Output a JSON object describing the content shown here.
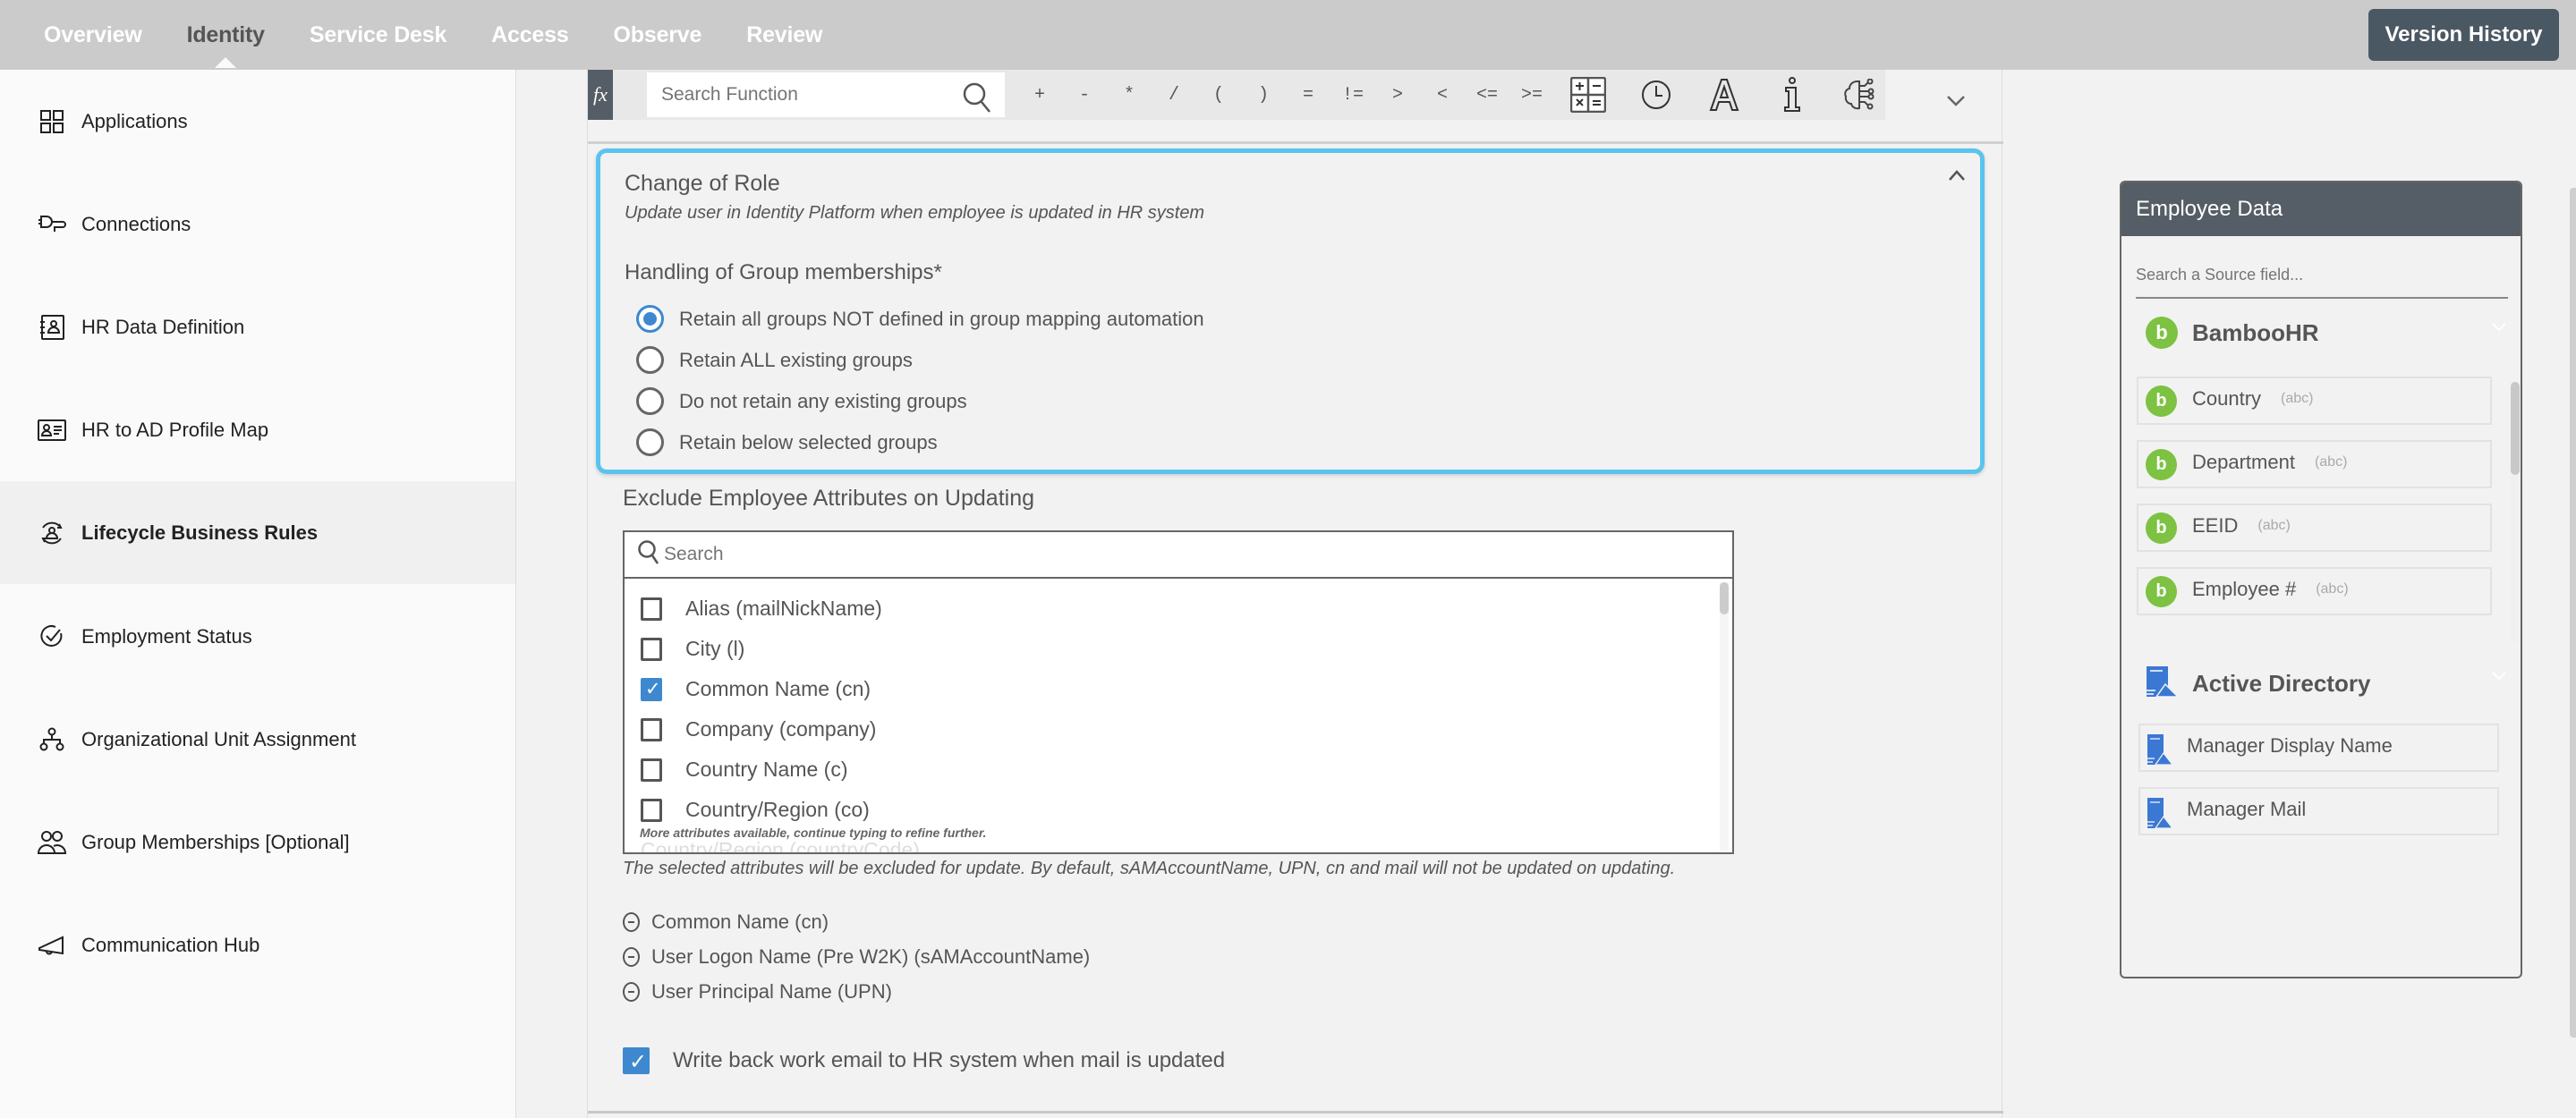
{
  "topnav": {
    "tabs": [
      {
        "label": "Overview",
        "active": false
      },
      {
        "label": "Identity",
        "active": true
      },
      {
        "label": "Service Desk",
        "active": false
      },
      {
        "label": "Access",
        "active": false
      },
      {
        "label": "Observe",
        "active": false
      },
      {
        "label": "Review",
        "active": false
      }
    ],
    "version_history_label": "Version History"
  },
  "sidebar": {
    "items": [
      {
        "label": "Applications",
        "icon": "applications-grid-icon",
        "active": false
      },
      {
        "label": "Connections",
        "icon": "plug-icon",
        "active": false
      },
      {
        "label": "HR Data Definition",
        "icon": "contact-book-icon",
        "active": false
      },
      {
        "label": "HR to AD Profile Map",
        "icon": "id-card-icon",
        "active": false
      },
      {
        "label": "Lifecycle Business Rules",
        "icon": "lifecycle-user-icon",
        "active": true
      },
      {
        "label": "Employment Status",
        "icon": "check-circle-icon",
        "active": false
      },
      {
        "label": "Organizational Unit Assignment",
        "icon": "org-hierarchy-icon",
        "active": false
      },
      {
        "label": "Group Memberships [Optional]",
        "icon": "users-group-icon",
        "active": false
      },
      {
        "label": "Communication Hub",
        "icon": "megaphone-icon",
        "active": false
      }
    ]
  },
  "formula_bar": {
    "fx_label": "fx",
    "search_placeholder": "Search Function",
    "operators": [
      "+",
      "-",
      "*",
      "/",
      "(",
      ")",
      "=",
      "!=",
      ">",
      "<",
      "<=",
      ">="
    ],
    "tools": [
      "calculator-icon",
      "clock-icon",
      "text-a-icon",
      "info-icon",
      "ai-brain-icon"
    ]
  },
  "role_card": {
    "title": "Change of Role",
    "subtitle": "Update user in Identity Platform when employee is updated in HR system",
    "handling_label": "Handling of Group memberships*",
    "options": [
      {
        "label": "Retain all groups NOT defined in group mapping automation",
        "selected": true
      },
      {
        "label": "Retain ALL existing groups",
        "selected": false
      },
      {
        "label": "Do not retain any existing groups",
        "selected": false
      },
      {
        "label": "Retain below selected groups",
        "selected": false
      }
    ]
  },
  "exclude": {
    "label": "Exclude Employee Attributes on Updating",
    "search_placeholder": "Search",
    "attributes": [
      {
        "label": "Alias (mailNickName)",
        "checked": false
      },
      {
        "label": "City (l)",
        "checked": false
      },
      {
        "label": "Common Name (cn)",
        "checked": true
      },
      {
        "label": "Company (company)",
        "checked": false
      },
      {
        "label": "Country Name (c)",
        "checked": false
      },
      {
        "label": "Country/Region (co)",
        "checked": false
      }
    ],
    "partial_next": "Country/Region (countryCode)",
    "more_hint": "More attributes available, continue typing to refine further.",
    "note": "The selected attributes will be excluded for update. By default, sAMAccountName, UPN, cn and mail will not be updated on updating.",
    "selected_defaults": [
      "Common Name (cn)",
      "User Logon Name (Pre W2K) (sAMAccountName)",
      "User Principal Name (UPN)"
    ]
  },
  "writeback": {
    "label": "Write back work email to HR system when mail is updated",
    "checked": true
  },
  "employee_data": {
    "title": "Employee Data",
    "search_placeholder": "Search a Source field...",
    "sources": [
      {
        "name": "BambooHR",
        "icon": "bamboohr-icon",
        "fields": [
          {
            "name": "Country",
            "type": "(abc)"
          },
          {
            "name": "Department",
            "type": "(abc)"
          },
          {
            "name": "EEID",
            "type": "(abc)"
          },
          {
            "name": "Employee #",
            "type": "(abc)"
          }
        ]
      },
      {
        "name": "Active Directory",
        "icon": "active-directory-icon",
        "fields": [
          {
            "name": "Manager Display Name"
          },
          {
            "name": "Manager Mail"
          }
        ]
      }
    ]
  },
  "colors": {
    "accent_blue": "#3e88cf",
    "card_border": "#5bc3ee",
    "nav_bg": "#cbcbcb",
    "dark_button": "#4a5863",
    "bamboo_green": "#7dc242"
  }
}
